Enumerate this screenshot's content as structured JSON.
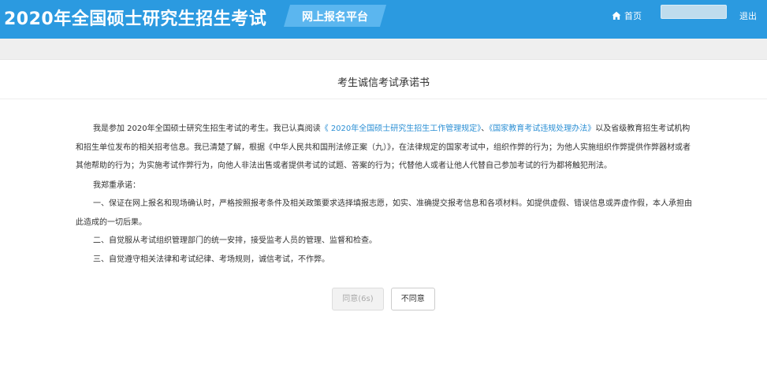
{
  "header": {
    "brand_title": "2020年全国硕士研究生招生考试",
    "platform_label": "网上报名平台",
    "home_label": "首页",
    "logout_label": "退出"
  },
  "page": {
    "title": "考生诚信考试承诺书"
  },
  "pledge": {
    "p1_text_a": "我是参加 2020年全国硕士研究生招生考试的考生。我已认真阅读",
    "p1_link_1": "《 2020年全国硕士研究生招生工作管理规定》",
    "p1_sep": "、",
    "p1_link_2": "《国家教育考试违规处理办法》",
    "p1_text_b": "以及省级教育招生考试机构和招生单位发布的相关招考信息。我已清楚了解，根据《中华人民共和国刑法修正案（九）》，在法律规定的国家考试中，组织作弊的行为；为他人实施组织作弊提供作弊器材或者其他帮助的行为；为实施考试作弊行为，向他人非法出售或者提供考试的试题、答案的行为；代替他人或者让他人代替自己参加考试的行为都将触犯刑法。",
    "promise_intro": "我郑重承诺：",
    "item_1": "一、保证在网上报名和现场确认时，严格按照报考条件及相关政策要求选择填报志愿，如实、准确提交报考信息和各项材料。如提供虚假、错误信息或弄虚作假，本人承担由此造成的一切后果。",
    "item_2": "二、自觉服从考试组织管理部门的统一安排，接受监考人员的管理、监督和检查。",
    "item_3": "三、自觉遵守相关法律和考试纪律、考场规则，诚信考试，不作弊。"
  },
  "buttons": {
    "agree_label": "同意(6s)",
    "disagree_label": "不同意"
  },
  "colors": {
    "header_bg": "#2b9ae0",
    "link": "#2b8fd4"
  },
  "icons": {
    "home": "home-icon"
  }
}
